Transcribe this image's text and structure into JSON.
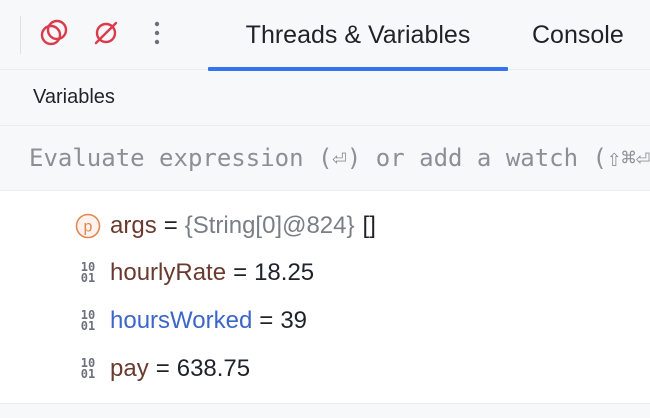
{
  "toolbar": {
    "buttons": [
      {
        "icon": "rerun-icon"
      },
      {
        "icon": "mute-breakpoints-icon"
      },
      {
        "icon": "more-vertical-icon"
      }
    ],
    "tabs": [
      {
        "label": "Threads & Variables",
        "active": true
      },
      {
        "label": "Console",
        "active": false
      }
    ]
  },
  "section": {
    "title": "Variables"
  },
  "evaluate": {
    "placeholder": "Evaluate expression (⏎) or add a watch (⇧⌘⏎)"
  },
  "variables": [
    {
      "icon": "parameter-icon",
      "name": "args",
      "type": "{String[0]@824}",
      "value": "[]",
      "name_color": "#6b3a2e"
    },
    {
      "icon": "primitive-icon",
      "name": "hourlyRate",
      "type": "",
      "value": "18.25",
      "name_color": "#6b3a2e"
    },
    {
      "icon": "primitive-icon",
      "name": "hoursWorked",
      "type": "",
      "value": "39",
      "name_color": "#3c66c8"
    },
    {
      "icon": "primitive-icon",
      "name": "pay",
      "type": "",
      "value": "638.75",
      "name_color": "#6b3a2e"
    }
  ],
  "colors": {
    "accent": "#3574f0",
    "breakpoint_red": "#db3b4b",
    "parameter_orange": "#e08855"
  }
}
